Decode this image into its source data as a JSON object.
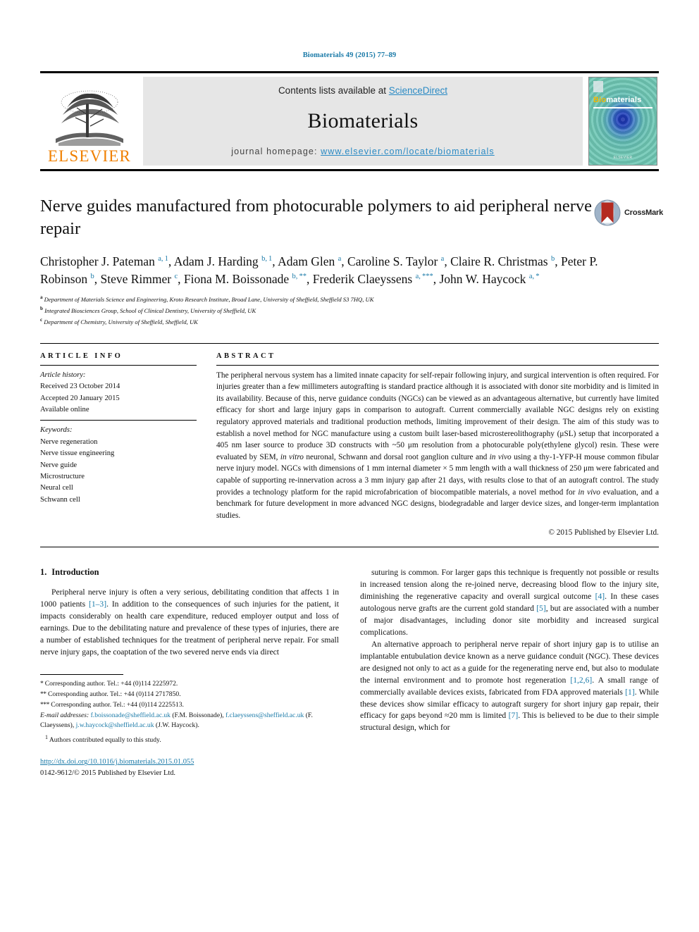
{
  "running_head": "Biomaterials 49 (2015) 77–89",
  "masthead": {
    "publisher": "ELSEVIER",
    "contents_prefix": "Contents lists available at ",
    "contents_link": "ScienceDirect",
    "journal_title": "Biomaterials",
    "homepage_prefix": "journal homepage: ",
    "homepage_url": "www.elsevier.com/locate/biomaterials",
    "cover_name_bio": "Bio",
    "cover_name_rest": "materials",
    "cover_footer": "ELSEVIER"
  },
  "article": {
    "title": "Nerve guides manufactured from photocurable polymers to aid peripheral nerve repair",
    "crossmark_label": "CrossMark",
    "authors_html": "Christopher J. Pateman <sup>a, 1</sup>, Adam J. Harding <sup>b, 1</sup>, Adam Glen <sup>a</sup>, Caroline S. Taylor <sup>a</sup>, Claire R. Christmas <sup>b</sup>, Peter P. Robinson <sup>b</sup>, Steve Rimmer <sup>c</sup>, Fiona M. Boissonade <sup>b, **</sup>, Frederik Claeyssens <sup>a, ***</sup>, John W. Haycock <sup>a, *</sup>",
    "affiliations": [
      {
        "mark": "a",
        "text": "Department of Materials Science and Engineering, Kroto Research Institute, Broad Lane, University of Sheffield, Sheffield S3 7HQ, UK"
      },
      {
        "mark": "b",
        "text": "Integrated Biosciences Group, School of Clinical Dentistry, University of Sheffield, UK"
      },
      {
        "mark": "c",
        "text": "Department of Chemistry, University of Sheffield, Sheffield, UK"
      }
    ]
  },
  "article_info": {
    "heading": "ARTICLE INFO",
    "history_label": "Article history:",
    "history": [
      "Received 23 October 2014",
      "Accepted 20 January 2015",
      "Available online"
    ],
    "keywords_label": "Keywords:",
    "keywords": [
      "Nerve regeneration",
      "Nerve tissue engineering",
      "Nerve guide",
      "Microstructure",
      "Neural cell",
      "Schwann cell"
    ]
  },
  "abstract": {
    "heading": "ABSTRACT",
    "text_html": "The peripheral nervous system has a limited innate capacity for self-repair following injury, and surgical intervention is often required. For injuries greater than a few millimeters autografting is standard practice although it is associated with donor site morbidity and is limited in its availability. Because of this, nerve guidance conduits (NGCs) can be viewed as an advantageous alternative, but currently have limited efficacy for short and large injury gaps in comparison to autograft. Current commercially available NGC designs rely on existing regulatory approved materials and traditional production methods, limiting improvement of their design. The aim of this study was to establish a novel method for NGC manufacture using a custom built laser-based microstereolithography (μSL) setup that incorporated a 405 nm laser source to produce 3D constructs with ~50 μm resolution from a photocurable poly(ethylene glycol) resin. These were evaluated by SEM, <em>in vitro</em> neuronal, Schwann and dorsal root ganglion culture and <em>in vivo</em> using a thy-1-YFP-H mouse common fibular nerve injury model. NGCs with dimensions of 1 mm internal diameter × 5 mm length with a wall thickness of 250 μm were fabricated and capable of supporting re-innervation across a 3 mm injury gap after 21 days, with results close to that of an autograft control. The study provides a technology platform for the rapid microfabrication of biocompatible materials, a novel method for <em>in vivo</em> evaluation, and a benchmark for future development in more advanced NGC designs, biodegradable and larger device sizes, and longer-term implantation studies.",
    "copyright": "© 2015 Published by Elsevier Ltd."
  },
  "body": {
    "section_number": "1.",
    "section_title": "Introduction",
    "left_paragraph_html": "Peripheral nerve injury is often a very serious, debilitating condition that affects 1 in 1000 patients <span class=\"ref\">[1–3]</span>. In addition to the consequences of such injuries for the patient, it impacts considerably on health care expenditure, reduced employer output and loss of earnings. Due to the debilitating nature and prevalence of these types of injuries, there are a number of established techniques for the treatment of peripheral nerve repair. For small nerve injury gaps, the coaptation of the two severed nerve ends via direct",
    "right_paragraph1_html": "suturing is common. For larger gaps this technique is frequently not possible or results in increased tension along the re-joined nerve, decreasing blood flow to the injury site, diminishing the regenerative capacity and overall surgical outcome <span class=\"ref\">[4]</span>. In these cases autologous nerve grafts are the current gold standard <span class=\"ref\">[5]</span>, but are associated with a number of major disadvantages, including donor site morbidity and increased surgical complications.",
    "right_paragraph2_html": "An alternative approach to peripheral nerve repair of short injury gap is to utilise an implantable entubulation device known as a nerve guidance conduit (NGC). These devices are designed not only to act as a guide for the regenerating nerve end, but also to modulate the internal environment and to promote host regeneration <span class=\"ref\">[1,2,6]</span>. A small range of commercially available devices exists, fabricated from FDA approved materials <span class=\"ref\">[1]</span>. While these devices show similar efficacy to autograft surgery for short injury gap repair, their efficacy for gaps beyond ≈20 mm is limited <span class=\"ref\">[7]</span>. This is believed to be due to their simple structural design, which for"
  },
  "footnotes": {
    "lines": [
      {
        "mark": "*",
        "text": "Corresponding author. Tel.: +44 (0)114 2225972."
      },
      {
        "mark": "**",
        "text": "Corresponding author. Tel.: +44 (0)114 2717850."
      },
      {
        "mark": "***",
        "text": "Corresponding author. Tel.: +44 (0)114 2225513."
      }
    ],
    "email_label": "E-mail addresses:",
    "email_html": " <a class=\"mail\" href=\"#\">f.boissonade@sheffield.ac.uk</a> (F.M. Boissonade), <a class=\"mail\" href=\"#\">f.claeyssens@sheffield.ac.uk</a> (F. Claeyssens), <a class=\"mail\" href=\"#\">j.w.haycock@sheffield.ac.uk</a> (J.W. Haycock).",
    "contributed_mark": "1",
    "contributed_text": "Authors contributed equally to this study."
  },
  "doi_block": {
    "doi_url": "http://dx.doi.org/10.1016/j.biomaterials.2015.01.055",
    "issn_line": "0142-9612/© 2015 Published by Elsevier Ltd."
  },
  "colors": {
    "link": "#1a7aa8",
    "sciencedirect": "#2a8ac4",
    "elsevier_orange": "#f08000",
    "band_gray": "#e6e6e6"
  }
}
